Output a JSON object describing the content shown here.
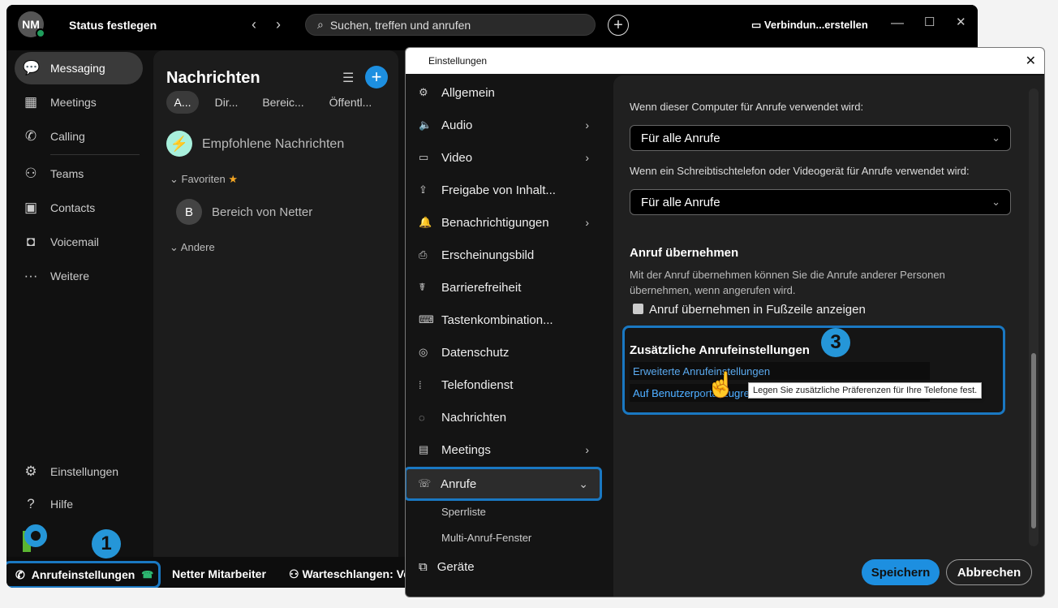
{
  "header": {
    "avatar_initials": "NM",
    "status": "Status festlegen",
    "search_placeholder": "Suchen, treffen und anrufen",
    "connect": "Verbindun...erstellen"
  },
  "sidebar": {
    "items": [
      {
        "label": "Messaging",
        "icon": "chat-bubble-icon"
      },
      {
        "label": "Meetings",
        "icon": "calendar-icon"
      },
      {
        "label": "Calling",
        "icon": "phone-icon"
      },
      {
        "label": "Teams",
        "icon": "people-icon"
      },
      {
        "label": "Contacts",
        "icon": "contact-card-icon"
      },
      {
        "label": "Voicemail",
        "icon": "voicemail-icon"
      },
      {
        "label": "Weitere",
        "icon": "more-icon"
      }
    ],
    "settings": "Einstellungen",
    "help": "Hilfe"
  },
  "messages": {
    "title": "Nachrichten",
    "tabs": [
      "A...",
      "Dir...",
      "Bereic...",
      "Öffentl..."
    ],
    "recommended": "Empfohlene Nachrichten",
    "favorites": "Favoriten",
    "space_initial": "B",
    "space": "Bereich von Netter",
    "other": "Andere"
  },
  "statusbar": {
    "call_settings": "Anrufeinstellungen",
    "user": "Netter Mitarbeiter",
    "queues": "Warteschlangen: Ve"
  },
  "badges": [
    "1",
    "2",
    "3"
  ],
  "dialog": {
    "title": "Einstellungen",
    "nav": [
      {
        "label": "Allgemein",
        "chevron": false
      },
      {
        "label": "Audio",
        "chevron": true
      },
      {
        "label": "Video",
        "chevron": true
      },
      {
        "label": "Freigabe von Inhalt...",
        "chevron": false
      },
      {
        "label": "Benachrichtigungen",
        "chevron": true
      },
      {
        "label": "Erscheinungsbild",
        "chevron": false
      },
      {
        "label": "Barrierefreiheit",
        "chevron": false
      },
      {
        "label": "Tastenkombination...",
        "chevron": false
      },
      {
        "label": "Datenschutz",
        "chevron": false
      },
      {
        "label": "Telefondienst",
        "chevron": false
      },
      {
        "label": "Nachrichten",
        "chevron": false
      },
      {
        "label": "Meetings",
        "chevron": true
      },
      {
        "label": "Anrufe",
        "chevron": true
      }
    ],
    "subnav": [
      "Sperrliste",
      "Multi-Anruf-Fenster"
    ],
    "devices": "Geräte",
    "content": {
      "computer_label": "Wenn dieser Computer für Anrufe verwendet wird:",
      "computer_value": "Für alle Anrufe",
      "desk_label": "Wenn ein Schreibtischtelefon oder Videogerät für Anrufe verwendet wird:",
      "desk_value": "Für alle Anrufe",
      "pickup_title": "Anruf übernehmen",
      "pickup_desc": "Mit der Anruf übernehmen können Sie die Anrufe anderer Personen übernehmen, wenn angerufen wird.",
      "pickup_checkbox": "Anruf übernehmen in Fußzeile anzeigen",
      "pickup_checked": false,
      "extra_title": "Zusätzliche Anrufeinstellungen",
      "advanced_link": "Erweiterte Anrufeinstellungen",
      "portal_link": "Auf Benutzerportal zugreifen",
      "portal_link_visible": "Auf Benutzerp",
      "portal_link_tail": "ug",
      "tooltip": "Legen Sie zusätzliche Präferenzen für Ihre Telefone fest."
    },
    "save": "Speichern",
    "cancel": "Abbrechen"
  },
  "colors": {
    "accent": "#1a78c2",
    "badge": "#2596d8",
    "link": "#4aa3f0",
    "presence": "#1f9d5c"
  }
}
